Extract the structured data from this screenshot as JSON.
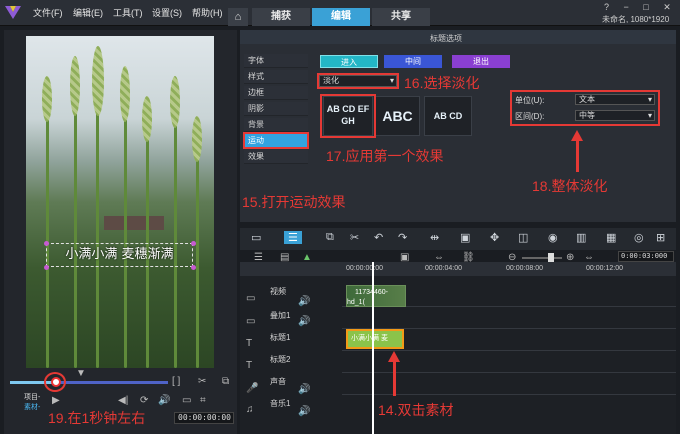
{
  "menu": [
    "文件(F)",
    "编辑(E)",
    "工具(T)",
    "设置(S)",
    "帮助(H)"
  ],
  "tabs": [
    "捕获",
    "编辑",
    "共享"
  ],
  "project_name": "未命名, 1080*1920",
  "options_title": "标题选项",
  "side_items": [
    "字体",
    "样式",
    "边框",
    "阴影",
    "背景",
    "运动",
    "效果"
  ],
  "motion_buttons": [
    "进入",
    "中间",
    "退出"
  ],
  "fade_select": "淡化",
  "thumbs": [
    "AB CD EF GH",
    "ABC",
    "AB CD"
  ],
  "unit_label": "单位(U):",
  "unit_value": "文本",
  "interval_label": "区间(D):",
  "interval_value": "中等",
  "caption": "小满小满 麦穗渐满",
  "project_label": "项目-",
  "clip_label": "素材-",
  "timecode": "00:00:00:00",
  "timecode_right": "0:00:03:000",
  "ruler_ticks": [
    "00:00:00:00",
    "00:00:04:00",
    "00:00:08:00",
    "00:00:12:00"
  ],
  "tracks": [
    "视频",
    "叠加1",
    "标题1",
    "标题2",
    "声音",
    "音乐1"
  ],
  "video_clip": "11734460-hd_1(",
  "title_clip": "小满小满 麦",
  "annotations": {
    "a15": "15.打开运动效果",
    "a16": "16.选择淡化",
    "a17": "17.应用第一个效果",
    "a18": "18.整体淡化",
    "a19": "19.在1秒钟左右",
    "a14": "14.双击素材"
  },
  "colors": {
    "accent": "#3aa1d6",
    "annotation": "#e53935"
  }
}
